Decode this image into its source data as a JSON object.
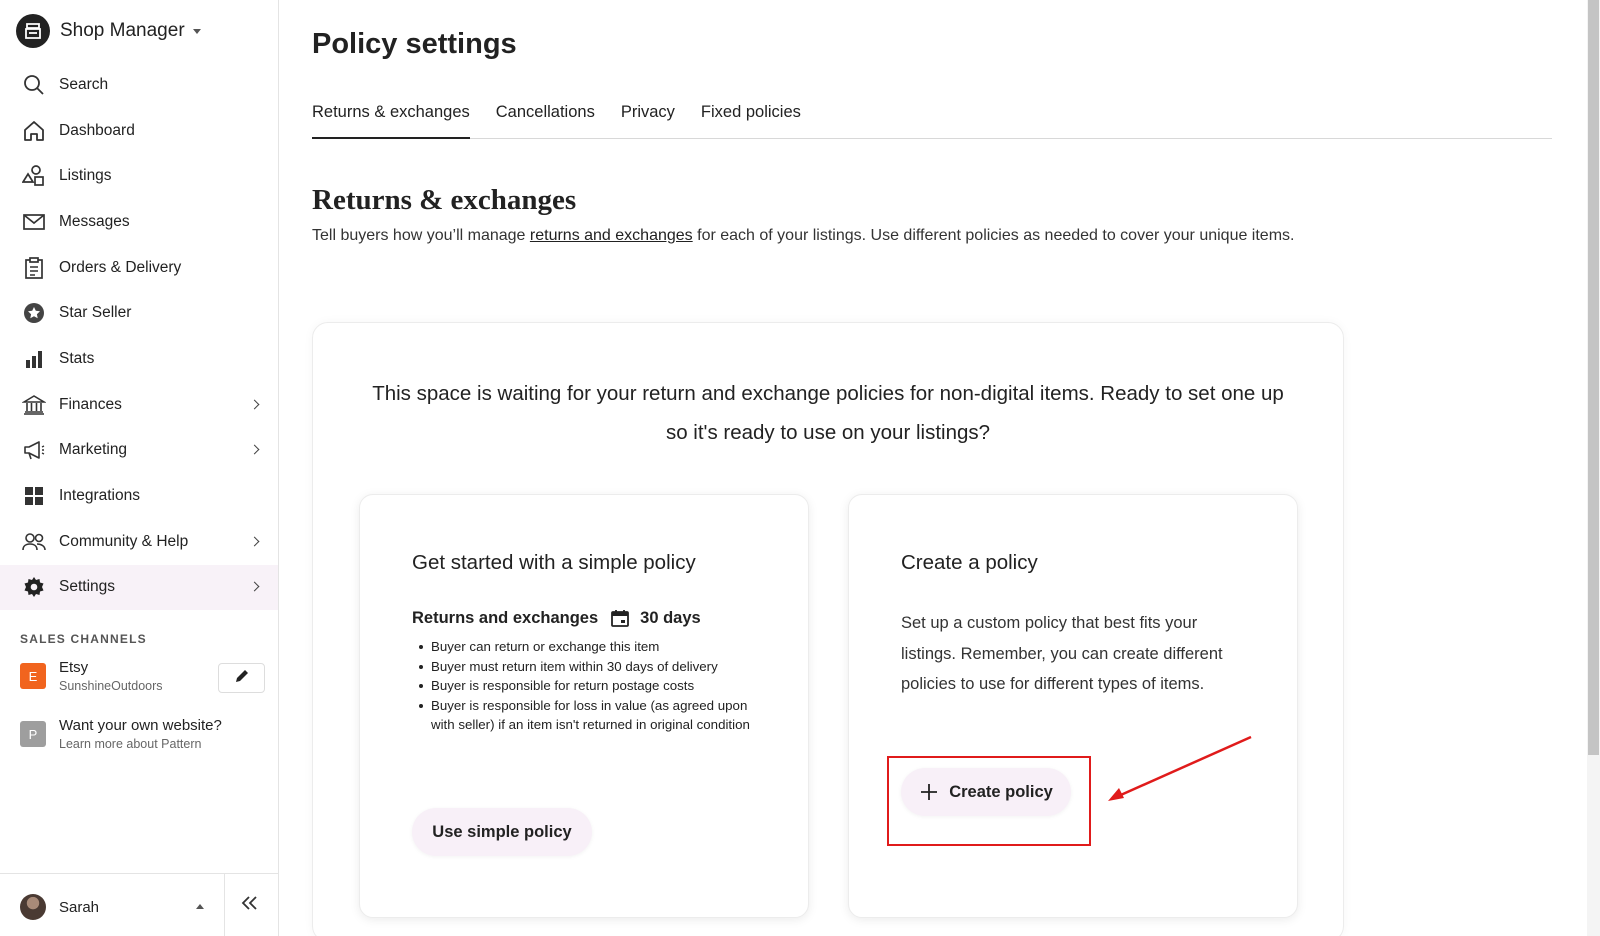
{
  "sidebar": {
    "shop_title": "Shop Manager",
    "nav": [
      {
        "label": "Search",
        "icon": "search-icon"
      },
      {
        "label": "Dashboard",
        "icon": "home-icon"
      },
      {
        "label": "Listings",
        "icon": "listings-shapes-icon"
      },
      {
        "label": "Messages",
        "icon": "envelope-icon"
      },
      {
        "label": "Orders & Delivery",
        "icon": "clipboard-icon"
      },
      {
        "label": "Star Seller",
        "icon": "star-badge-icon"
      },
      {
        "label": "Stats",
        "icon": "bar-chart-icon"
      },
      {
        "label": "Finances",
        "icon": "bank-icon"
      },
      {
        "label": "Marketing",
        "icon": "megaphone-icon"
      },
      {
        "label": "Integrations",
        "icon": "grid-icon"
      },
      {
        "label": "Community & Help",
        "icon": "people-icon"
      },
      {
        "label": "Settings",
        "icon": "gear-icon"
      }
    ],
    "sales_channels_title": "SALES CHANNELS",
    "channels": [
      {
        "badge": "E",
        "name": "Etsy",
        "sub": "SunshineOutdoors",
        "color": "#f1641e"
      },
      {
        "badge": "P",
        "name": "Want your own website?",
        "sub": "Learn more about Pattern",
        "color": "#9e9e9e"
      }
    ],
    "user_name": "Sarah"
  },
  "main": {
    "page_title": "Policy settings",
    "tabs": [
      {
        "label": "Returns & exchanges",
        "active": true
      },
      {
        "label": "Cancellations"
      },
      {
        "label": "Privacy"
      },
      {
        "label": "Fixed policies"
      }
    ],
    "section_title": "Returns & exchanges",
    "desc_before": "Tell buyers how you’ll manage ",
    "desc_link": "returns and exchanges",
    "desc_after": " for each of your listings. Use different policies as needed to cover your unique items.",
    "empty_message": "This space is waiting for your return and exchange policies for non-digital items. Ready to set one up so it's ready to use on your listings?",
    "simple_card": {
      "title": "Get started with a simple policy",
      "policy_label": "Returns and exchanges",
      "days": "30 days",
      "rules": [
        "Buyer can return or exchange this item",
        "Buyer must return item within 30 days of delivery",
        "Buyer is responsible for return postage costs",
        "Buyer is responsible for loss in value (as agreed upon with seller) if an item isn't returned in original condition"
      ],
      "button": "Use simple policy"
    },
    "create_card": {
      "title": "Create a policy",
      "description": "Set up a custom policy that best fits your listings. Remember, you can create different policies to use for different types of items.",
      "button": "Create policy"
    }
  },
  "colors": {
    "highlight": "#e01b1b",
    "active_bg": "#f8f2f8",
    "button_bg": "#f8f0f8"
  }
}
